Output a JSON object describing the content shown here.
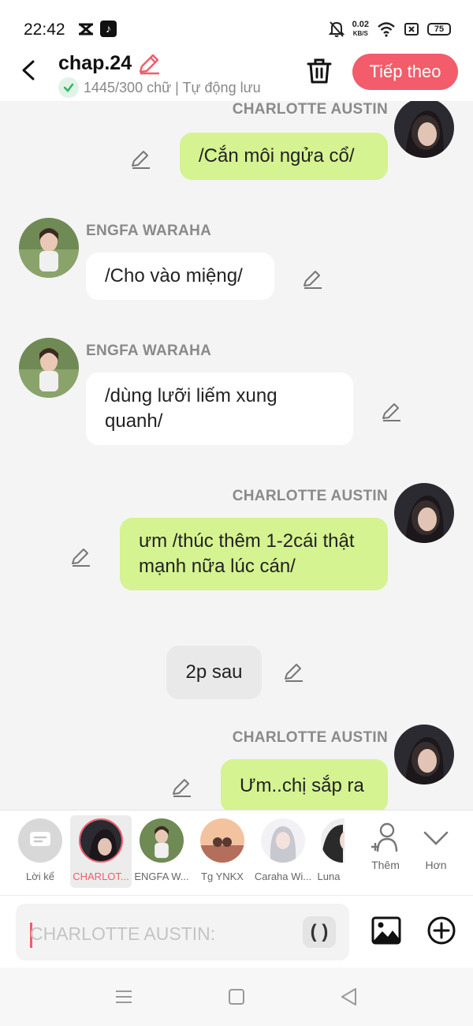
{
  "status_bar": {
    "time": "22:42",
    "net_speed": "0.02",
    "net_unit": "KB/S",
    "battery": "75"
  },
  "header": {
    "title": "chap.24",
    "save_status": "1445/300 chữ | Tự động lưu",
    "next_button": "Tiếp theo"
  },
  "messages": [
    {
      "speaker": "CHARLOTTE AUSTIN",
      "side": "right",
      "text": "/Cắn môi ngửa cổ/"
    },
    {
      "speaker": "ENGFA WARAHA",
      "side": "left",
      "text": "/Cho vào miệng/"
    },
    {
      "speaker": "ENGFA WARAHA",
      "side": "left",
      "text": "/dùng lưỡi liếm xung quanh/"
    },
    {
      "speaker": "CHARLOTTE AUSTIN",
      "side": "right",
      "text": "ưm /thúc thêm 1-2cái thật mạnh nữa lúc cán/"
    },
    {
      "speaker": "",
      "side": "narration",
      "text": "2p sau"
    },
    {
      "speaker": "CHARLOTTE AUSTIN",
      "side": "right",
      "text": "Ưm..chị sắp ra"
    }
  ],
  "characters": [
    {
      "label": "Lời kể"
    },
    {
      "label": "CHARLOT..."
    },
    {
      "label": "ENGFA W..."
    },
    {
      "label": "Tg YNKX"
    },
    {
      "label": "Caraha Wi..."
    },
    {
      "label": "Luna"
    }
  ],
  "actions": {
    "add_label": "Thêm",
    "more_label": "Hơn"
  },
  "input": {
    "placeholder": "CHARLOTTE AUSTIN:",
    "paren_button": "( )"
  },
  "colors": {
    "accent": "#f25c6b",
    "bubble_green": "#d5f391",
    "bubble_white": "#ffffff",
    "narration": "#e9e9e9"
  }
}
